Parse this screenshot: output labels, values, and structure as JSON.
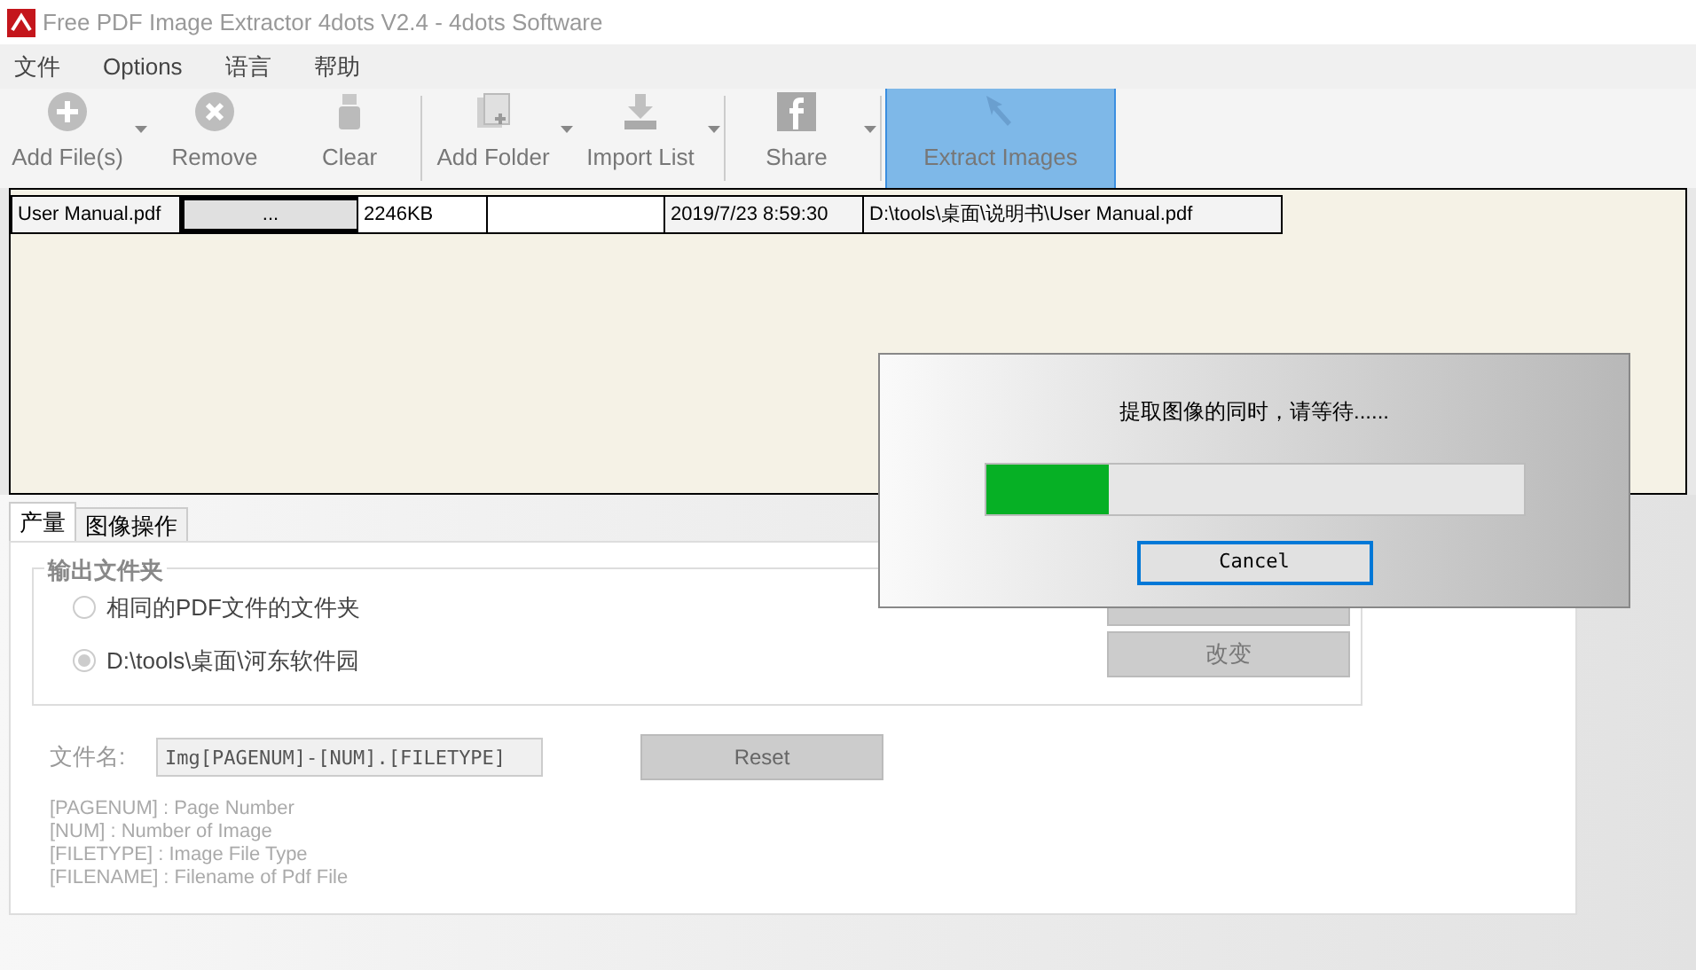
{
  "window": {
    "title": "Free PDF Image Extractor 4dots V2.4 - 4dots Software"
  },
  "menu": [
    "文件",
    "Options",
    "语言",
    "帮助"
  ],
  "toolbar": [
    {
      "kind": "add",
      "label": "Add File(s)",
      "dropdown": true,
      "selected": false
    },
    {
      "kind": "remove",
      "label": "Remove",
      "dropdown": false,
      "selected": false
    },
    {
      "kind": "clear",
      "label": "Clear",
      "dropdown": false,
      "selected": false
    },
    {
      "kind": "folder",
      "label": "Add Folder",
      "dropdown": true,
      "selected": false
    },
    {
      "kind": "import",
      "label": "Import List",
      "dropdown": true,
      "selected": false
    },
    {
      "kind": "share",
      "label": "Share",
      "dropdown": true,
      "selected": false
    },
    {
      "kind": "extract",
      "label": "Extract Images",
      "dropdown": false,
      "selected": true
    }
  ],
  "file_table": {
    "rows": [
      [
        "User Manual.pdf",
        "...",
        "2246KB",
        "",
        "2019/7/23 8:59:30",
        "D:\\tools\\桌面\\说明书\\User Manual.pdf"
      ]
    ]
  },
  "tabs": [
    {
      "label": "产量",
      "selected": true
    },
    {
      "label": "图像操作",
      "selected": false
    }
  ],
  "output_folder": {
    "legend": "输出文件夹",
    "options": [
      {
        "label": "相同的PDF文件的文件夹",
        "selected": false
      },
      {
        "label": "D:\\tools\\桌面\\河东软件园",
        "selected": true
      }
    ],
    "buttons": [
      "改变"
    ]
  },
  "filename": {
    "label": "文件名:",
    "value": "Img[PAGENUM]-[NUM].[FILETYPE]",
    "reset": "Reset",
    "hints": [
      "[PAGENUM] : Page Number",
      "[NUM] : Number of Image",
      "[FILETYPE] : Image File Type",
      "[FILENAME] : Filename of Pdf File"
    ]
  },
  "progress_dialog": {
    "message": "提取图像的同时，请等待......",
    "level": 0.23,
    "cancel": "Cancel"
  }
}
